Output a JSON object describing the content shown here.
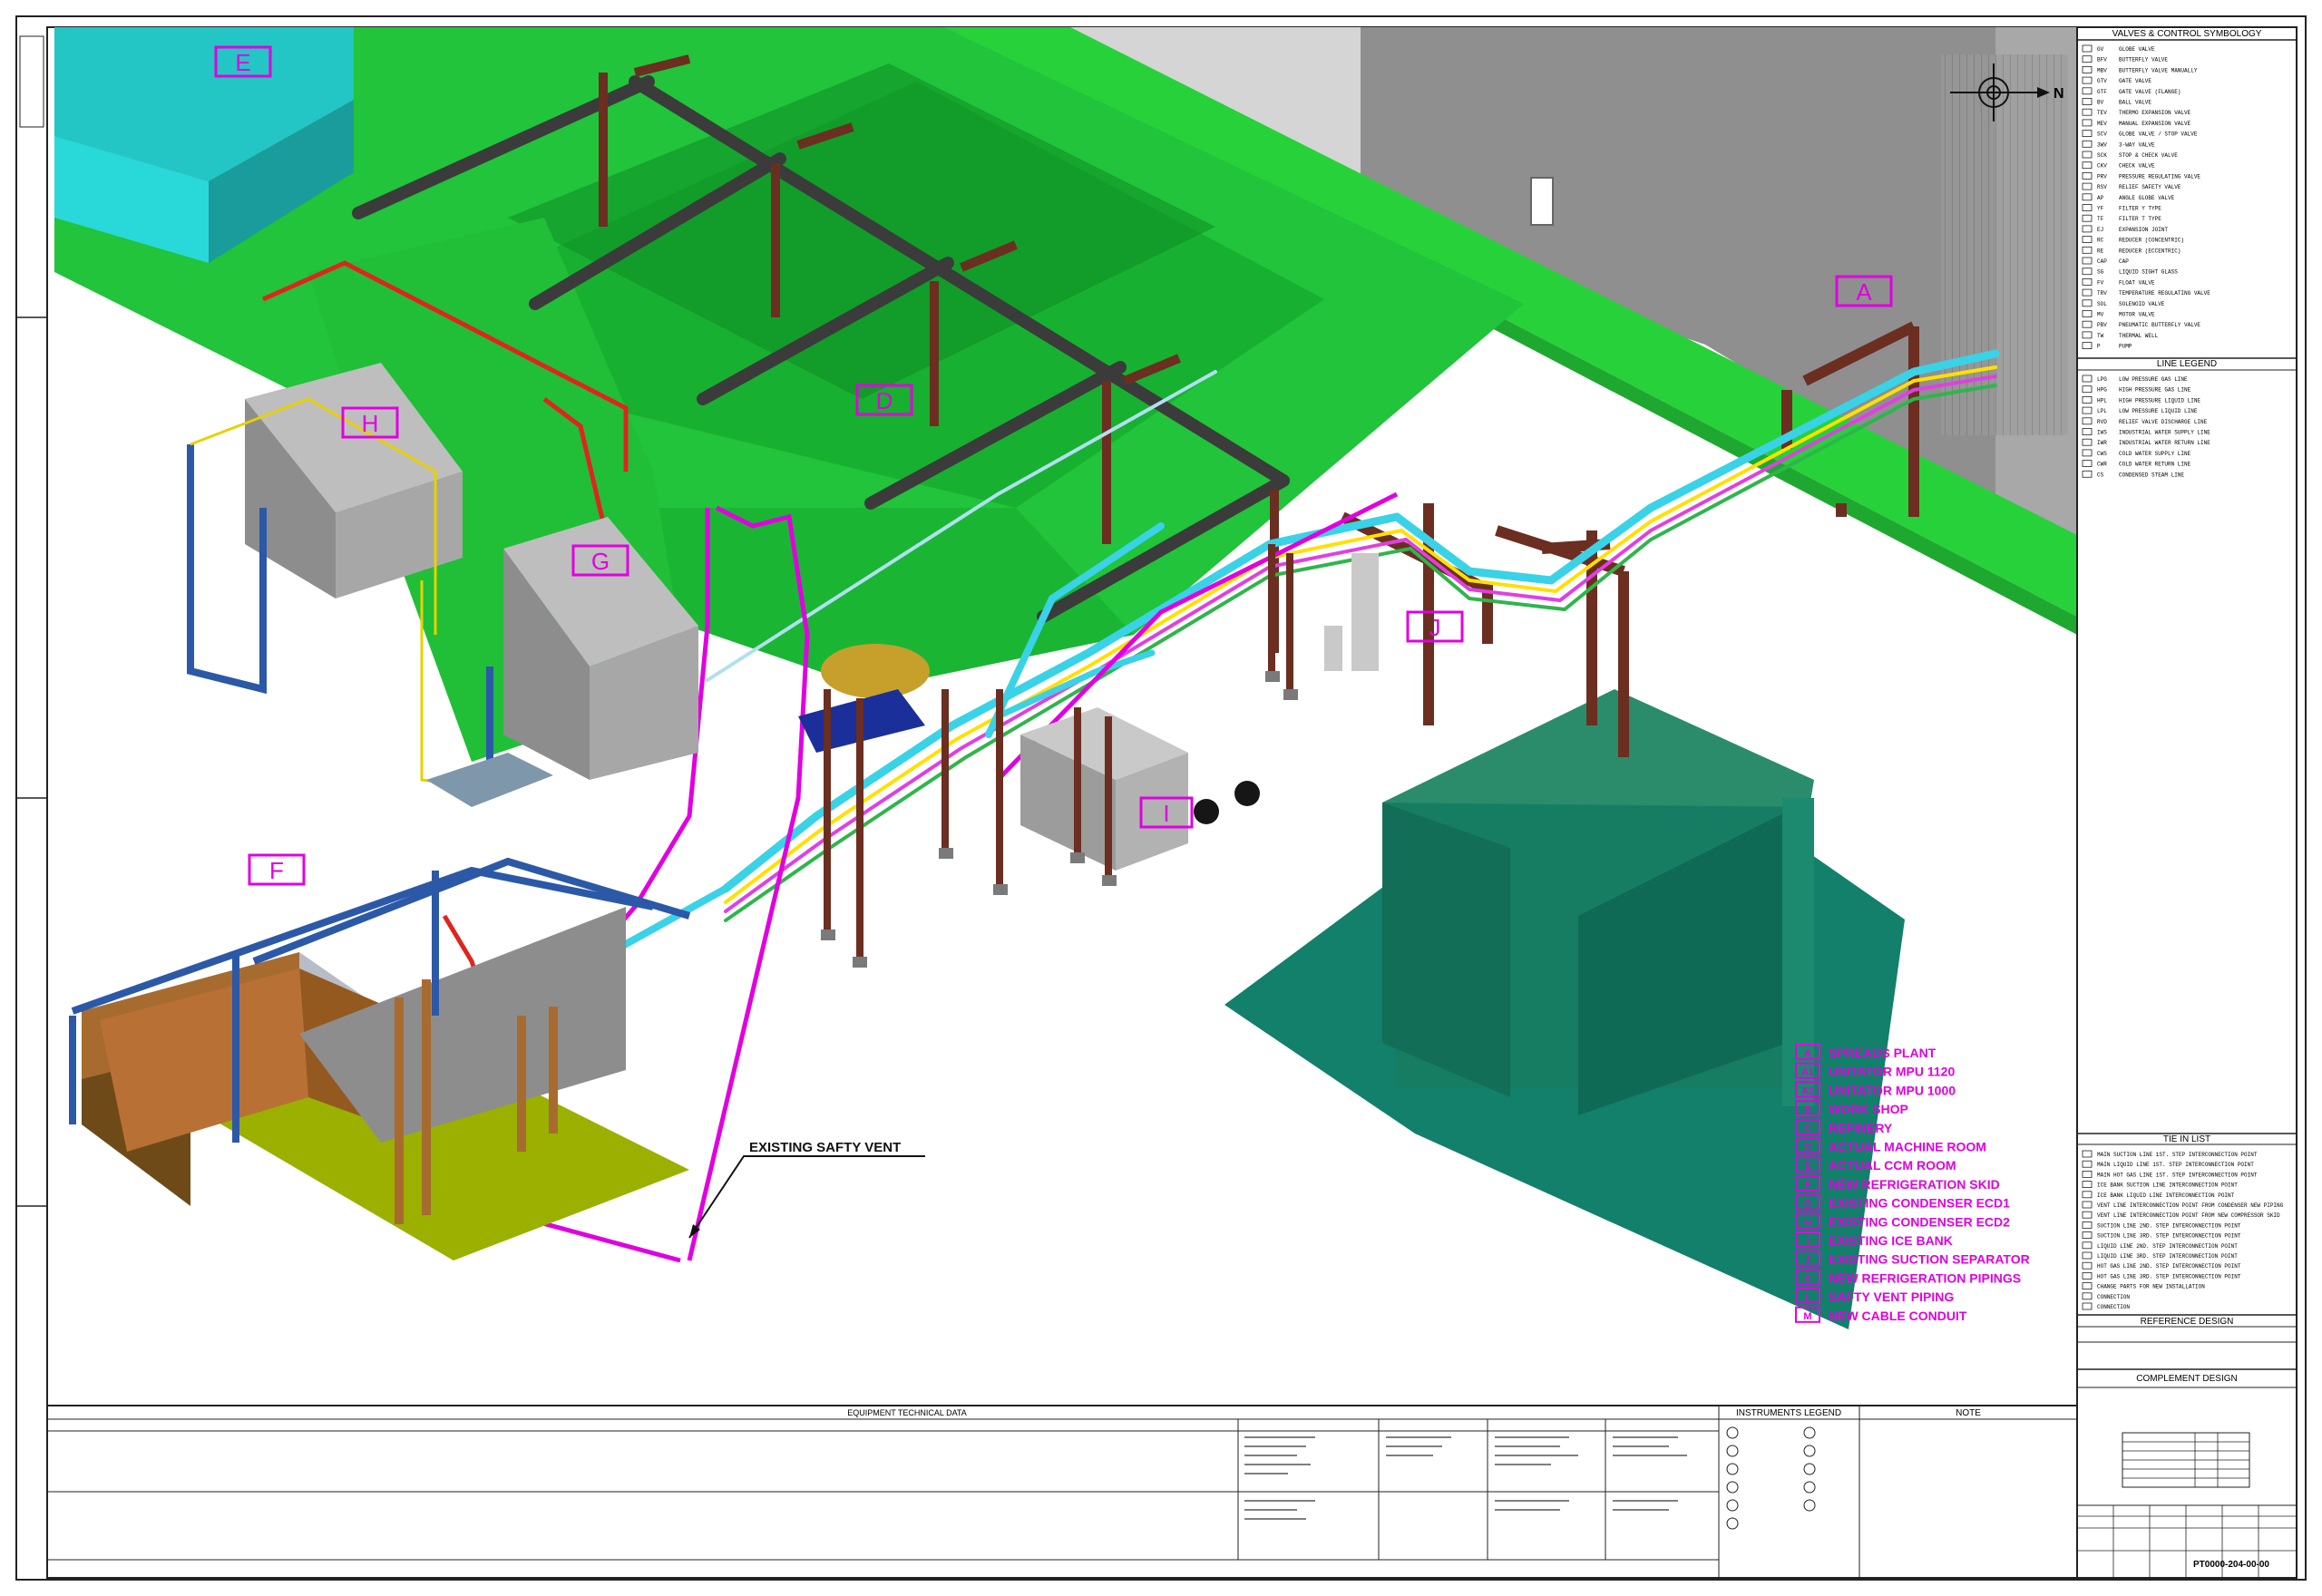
{
  "callouts": {
    "A": "A",
    "D": "D",
    "E": "E",
    "F": "F",
    "G": "G",
    "H": "H",
    "I": "I",
    "J": "J"
  },
  "annotation": {
    "safety_vent": "EXISTING SAFTY VENT"
  },
  "legend": [
    {
      "code": "A",
      "text": "SPREADS PLANT"
    },
    {
      "code": "A1",
      "text": "UNITATOR MPU 1120"
    },
    {
      "code": "A2",
      "text": "UNITATOR MPU 1000"
    },
    {
      "code": "B",
      "text": "WORK SHOP"
    },
    {
      "code": "C",
      "text": "REFINERY"
    },
    {
      "code": "D",
      "text": "ACTUAL MACHINE ROOM"
    },
    {
      "code": "E",
      "text": "ACTUAL CCM ROOM"
    },
    {
      "code": "F",
      "text": "NEW REFRIGERATION SKID"
    },
    {
      "code": "G",
      "text": "EXISTING CONDENSER ECD1"
    },
    {
      "code": "H",
      "text": "EXISTING CONDENSER ECD2"
    },
    {
      "code": "I",
      "text": "EXISTING ICE BANK"
    },
    {
      "code": "J",
      "text": "EXISTING SUCTION SEPARATOR"
    },
    {
      "code": "K",
      "text": "NEW REFRIGERATION PIPINGS"
    },
    {
      "code": "L",
      "text": "SAFTY VENT PIPING"
    },
    {
      "code": "M",
      "text": "NEW CABLE CONDUIT"
    }
  ],
  "side_panel": {
    "valves_title": "VALVES & CONTROL SYMBOLOGY",
    "valves": [
      {
        "code": "GV",
        "name": "GLOBE VALVE"
      },
      {
        "code": "BFV",
        "name": "BUTTERFLY VALVE"
      },
      {
        "code": "MBV",
        "name": "BUTTERFLY VALVE MANUALLY"
      },
      {
        "code": "GTV",
        "name": "GATE VALVE"
      },
      {
        "code": "GTF",
        "name": "GATE VALVE (FLANGE)"
      },
      {
        "code": "BV",
        "name": "BALL VALVE"
      },
      {
        "code": "TEV",
        "name": "THERMO EXPANSION VALVE"
      },
      {
        "code": "MEV",
        "name": "MANUAL EXPANSION VALVE"
      },
      {
        "code": "SCV",
        "name": "GLOBE VALVE / STOP VALVE"
      },
      {
        "code": "3WV",
        "name": "3-WAY VALVE"
      },
      {
        "code": "SCK",
        "name": "STOP & CHECK VALVE"
      },
      {
        "code": "CKV",
        "name": "CHECK VALVE"
      },
      {
        "code": "PRV",
        "name": "PRESSURE REGULATING VALVE"
      },
      {
        "code": "RSV",
        "name": "RELIEF SAFETY VALVE"
      },
      {
        "code": "AP",
        "name": "ANGLE GLOBE VALVE"
      },
      {
        "code": "YF",
        "name": "FILTER Y TYPE"
      },
      {
        "code": "TF",
        "name": "FILTER T TYPE"
      },
      {
        "code": "EJ",
        "name": "EXPANSION JOINT"
      },
      {
        "code": "RC",
        "name": "REDUCER (CONCENTRIC)"
      },
      {
        "code": "RE",
        "name": "REDUCER (ECCENTRIC)"
      },
      {
        "code": "CAP",
        "name": "CAP"
      },
      {
        "code": "SG",
        "name": "LIQUID SIGHT GLASS"
      },
      {
        "code": "FV",
        "name": "FLOAT VALVE"
      },
      {
        "code": "TRV",
        "name": "TEMPERATURE REGULATING VALVE"
      },
      {
        "code": "SOL",
        "name": "SOLENOID VALVE"
      },
      {
        "code": "MV",
        "name": "MOTOR VALVE"
      },
      {
        "code": "PBV",
        "name": "PNEUMATIC BUTTERFLY VALVE"
      },
      {
        "code": "TW",
        "name": "THERMAL WELL"
      },
      {
        "code": "P",
        "name": "PUMP"
      }
    ],
    "line_title": "LINE LEGEND",
    "lines": [
      {
        "code": "LPG",
        "name": "LOW PRESSURE GAS LINE"
      },
      {
        "code": "HPG",
        "name": "HIGH PRESSURE GAS LINE"
      },
      {
        "code": "HPL",
        "name": "HIGH PRESSURE LIQUID LINE"
      },
      {
        "code": "LPL",
        "name": "LOW PRESSURE LIQUID LINE"
      },
      {
        "code": "RVD",
        "name": "RELIEF VALVE DISCHARGE LINE"
      },
      {
        "code": "IWS",
        "name": "INDUSTRIAL WATER SUPPLY LINE"
      },
      {
        "code": "IWR",
        "name": "INDUSTRIAL WATER RETURN LINE"
      },
      {
        "code": "CWS",
        "name": "COLD WATER SUPPLY LINE"
      },
      {
        "code": "CWR",
        "name": "COLD WATER RETURN LINE"
      },
      {
        "code": "CS",
        "name": "CONDENSED STEAM LINE"
      }
    ],
    "tiein_title": "TIE IN LIST",
    "tieins": [
      "MAIN SUCTION LINE 1ST. STEP INTERCONNECTION POINT",
      "MAIN LIQUID LINE 1ST. STEP INTERCONNECTION POINT",
      "MAIN HOT GAS LINE 1ST. STEP INTERCONNECTION POINT",
      "ICE BANK SUCTION LINE INTERCONNECTION POINT",
      "ICE BANK LIQUID LINE INTERCONNECTION POINT",
      "VENT LINE INTERCONNECTION POINT FROM CONDENSER NEW PIPING",
      "VENT LINE INTERCONNECTION POINT FROM NEW COMPRESSOR SKID",
      "SUCTION LINE 2ND. STEP INTERCONNECTION POINT",
      "SUCTION LINE 3RD. STEP INTERCONNECTION POINT",
      "LIQUID LINE 2ND. STEP INTERCONNECTION POINT",
      "LIQUID LINE 3RD. STEP INTERCONNECTION POINT",
      "HOT GAS LINE 2ND. STEP INTERCONNECTION POINT",
      "HOT GAS LINE 3RD. STEP INTERCONNECTION POINT",
      "CHANGE PARTS FOR NEW INSTALLATION",
      "CONNECTION",
      "CONNECTION"
    ],
    "ref_design_title": "REFERENCE DESIGN",
    "complement_title": "COMPLEMENT DESIGN",
    "drawing_number": "PT0000-204-00-00"
  },
  "bottom": {
    "table_title": "EQUIPMENT TECHNICAL DATA",
    "instruments_title": "INSTRUMENTS LEGEND",
    "note_title": "NOTE"
  }
}
